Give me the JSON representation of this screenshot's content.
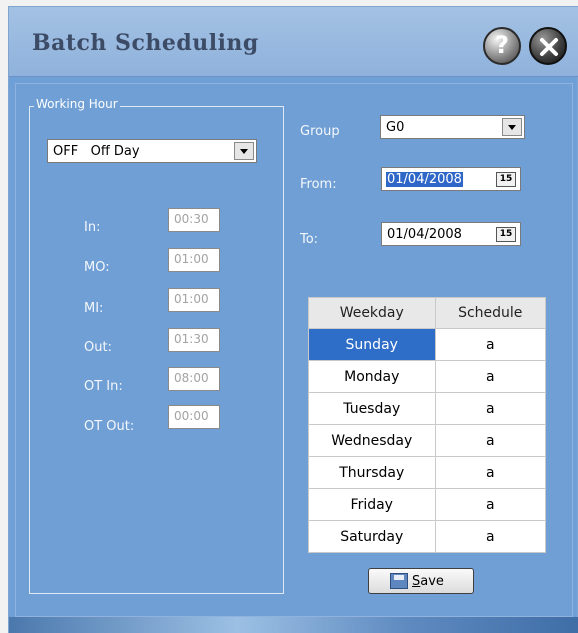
{
  "window": {
    "title": "Batch Scheduling"
  },
  "working_hour": {
    "legend": "Working Hour",
    "shift_select": "OFF   Off Day",
    "fields": [
      {
        "label": "In:",
        "value": "00:30"
      },
      {
        "label": "MO:",
        "value": "01:00"
      },
      {
        "label": "MI:",
        "value": "01:00"
      },
      {
        "label": "Out:",
        "value": "01:30"
      },
      {
        "label": "OT In:",
        "value": "08:00"
      },
      {
        "label": "OT Out:",
        "value": "00:00"
      }
    ]
  },
  "group": {
    "label": "Group",
    "value": "G0"
  },
  "from": {
    "label": "From:",
    "value": "01/04/2008"
  },
  "to": {
    "label": "To:",
    "value": "01/04/2008"
  },
  "calendar_icon_text": "15",
  "schedule_table": {
    "headers": [
      "Weekday",
      "Schedule"
    ],
    "rows": [
      [
        "Sunday",
        "a"
      ],
      [
        "Monday",
        "a"
      ],
      [
        "Tuesday",
        "a"
      ],
      [
        "Wednesday",
        "a"
      ],
      [
        "Thursday",
        "a"
      ],
      [
        "Friday",
        "a"
      ],
      [
        "Saturday",
        "a"
      ]
    ],
    "selected_row": 0
  },
  "save_button": {
    "accel": "S",
    "rest": "ave"
  },
  "icons": {
    "help": "help-icon",
    "close": "close-icon",
    "calendar": "calendar-icon",
    "save": "save-icon"
  }
}
